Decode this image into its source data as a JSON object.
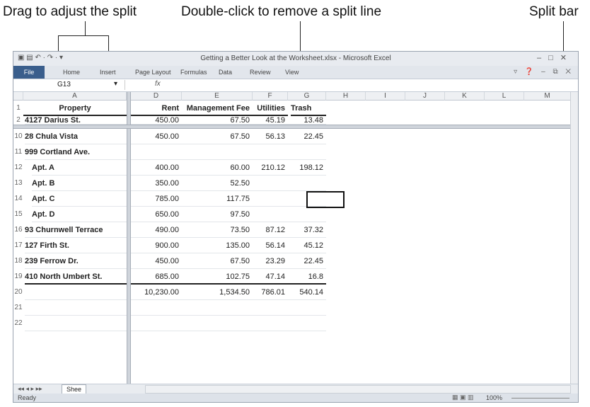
{
  "callouts": {
    "drag": "Drag to adjust the split",
    "dblclick": "Double-click to remove a split line",
    "splitbar": "Split bar"
  },
  "window": {
    "title": "Getting a Better Look at the Worksheet.xlsx - Microsoft Excel"
  },
  "ribbon": {
    "tabs": [
      "File",
      "Home",
      "Insert",
      "Page Layout",
      "Formulas",
      "Data",
      "Review",
      "View"
    ]
  },
  "formula_bar": {
    "name_box": "G13",
    "fx": "fx",
    "value": ""
  },
  "columns": [
    "A",
    "D",
    "E",
    "F",
    "G",
    "H",
    "I",
    "J",
    "K",
    "L",
    "M"
  ],
  "rows": [
    {
      "n": "1",
      "a": "Property",
      "d": "Rent",
      "e": "Management Fee",
      "f": "Utilities",
      "g": "Trash",
      "header": true
    },
    {
      "n": "2",
      "a": "4127 Darius St.",
      "d": "450.00",
      "e": "67.50",
      "f": "45.19",
      "g": "13.48"
    },
    {
      "n": "10",
      "a": "28 Chula Vista",
      "d": "450.00",
      "e": "67.50",
      "f": "56.13",
      "g": "22.45"
    },
    {
      "n": "11",
      "a": "999 Cortland Ave.",
      "d": "",
      "e": "",
      "f": "",
      "g": ""
    },
    {
      "n": "12",
      "a": "Apt. A",
      "d": "400.00",
      "e": "60.00",
      "f": "210.12",
      "g": "198.12",
      "indent": true
    },
    {
      "n": "13",
      "a": "Apt. B",
      "d": "350.00",
      "e": "52.50",
      "f": "",
      "g": "",
      "indent": true
    },
    {
      "n": "14",
      "a": "Apt. C",
      "d": "785.00",
      "e": "117.75",
      "f": "",
      "g": "",
      "indent": true
    },
    {
      "n": "15",
      "a": "Apt. D",
      "d": "650.00",
      "e": "97.50",
      "f": "",
      "g": "",
      "indent": true
    },
    {
      "n": "16",
      "a": "93 Churnwell Terrace",
      "d": "490.00",
      "e": "73.50",
      "f": "87.12",
      "g": "37.32"
    },
    {
      "n": "17",
      "a": "127 Firth St.",
      "d": "900.00",
      "e": "135.00",
      "f": "56.14",
      "g": "45.12"
    },
    {
      "n": "18",
      "a": "239 Ferrow Dr.",
      "d": "450.00",
      "e": "67.50",
      "f": "23.29",
      "g": "22.45"
    },
    {
      "n": "19",
      "a": "410 North Umbert St.",
      "d": "685.00",
      "e": "102.75",
      "f": "47.14",
      "g": "16.8"
    },
    {
      "n": "20",
      "a": "",
      "d": "10,230.00",
      "e": "1,534.50",
      "f": "786.01",
      "g": "540.14"
    },
    {
      "n": "21",
      "a": "",
      "d": "",
      "e": "",
      "f": "",
      "g": ""
    },
    {
      "n": "22",
      "a": "",
      "d": "",
      "e": "",
      "f": "",
      "g": ""
    }
  ],
  "sheet_tab": "Shee",
  "status": {
    "ready": "Ready",
    "zoom": "100%"
  }
}
